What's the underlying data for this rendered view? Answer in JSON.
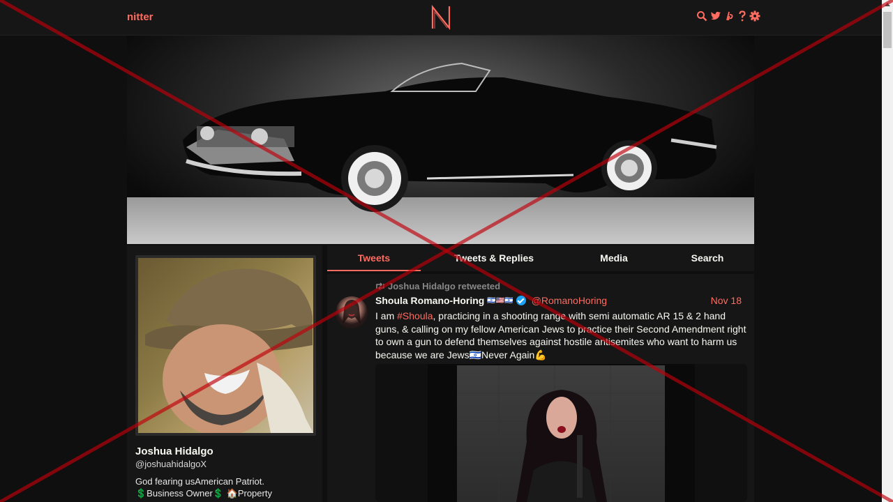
{
  "nav": {
    "brand": "nitter",
    "logo_letter": "N",
    "icons": [
      "search-icon",
      "twitter-icon",
      "rss-icon",
      "help-icon",
      "gear-icon"
    ]
  },
  "profile": {
    "fullname": "Joshua Hidalgo",
    "username": "@joshuahidalgoX",
    "bio_lines": [
      "God fearing usAmerican Patriot.",
      "💲Business Owner💲 🏠Property"
    ]
  },
  "tabs": [
    {
      "label": "Tweets",
      "active": true
    },
    {
      "label": "Tweets & Replies",
      "active": false
    },
    {
      "label": "Media",
      "active": false
    },
    {
      "label": "Search",
      "active": false
    }
  ],
  "tweet": {
    "retweet_label": "Joshua Hidalgo retweeted",
    "fullname": "Shoula Romano-Horing",
    "fullname_suffix": "🇮🇱🇺🇸🇮🇱",
    "username": "@RomanoHoring",
    "date": "Nov 18",
    "text_before_tag": "I am ",
    "hashtag": "#Shoula",
    "text_after_tag": ", practicing in a shooting range with semi automatic AR 15 & 2 hand guns, & calling on my fellow American Jews to practice their Second Amendment right to own a gun to defend themselves against hostile antisemites who want to harm us because we are Jews🇮🇱Never Again💪"
  },
  "colors": {
    "accent": "#ff6c60",
    "background": "#0f0f0f",
    "panel": "#161616",
    "overlay_x": "#c0000a"
  }
}
